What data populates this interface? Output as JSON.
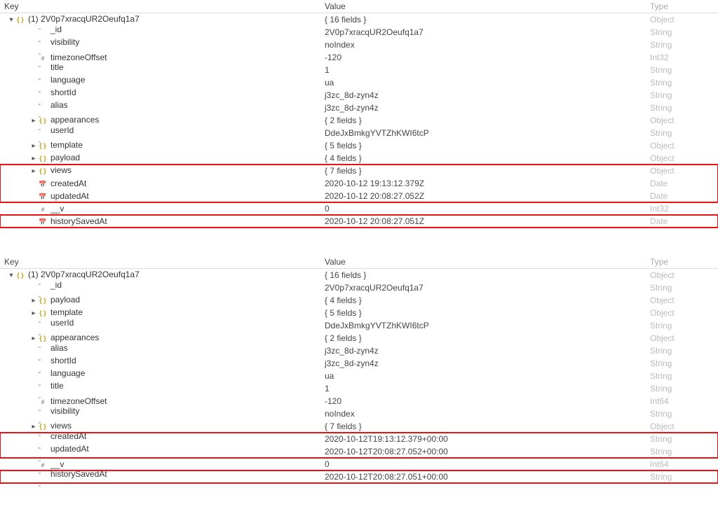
{
  "headers": {
    "key": "Key",
    "value": "Value",
    "type": "Type"
  },
  "panels": [
    {
      "rootExpander": "v",
      "rootKey": "(1) 2V0p7xracqUR2Oeufq1a7",
      "rootValue": "{ 16 fields }",
      "rootType": "Object",
      "rootIcon": "object",
      "rows": [
        {
          "exp": "",
          "icon": "string",
          "key": "_id",
          "value": "2V0p7xracqUR2Oeufq1a7",
          "type": "String",
          "indent": 2
        },
        {
          "exp": "",
          "icon": "string",
          "key": "visibility",
          "value": "noIndex",
          "type": "String",
          "indent": 2
        },
        {
          "exp": "",
          "icon": "int",
          "key": "timezoneOffset",
          "value": "-120",
          "type": "Int32",
          "indent": 2
        },
        {
          "exp": "",
          "icon": "string",
          "key": "title",
          "value": "1",
          "type": "String",
          "indent": 2
        },
        {
          "exp": "",
          "icon": "string",
          "key": "language",
          "value": "ua",
          "type": "String",
          "indent": 2
        },
        {
          "exp": "",
          "icon": "string",
          "key": "shortId",
          "value": "j3zc_8d-zyn4z",
          "type": "String",
          "indent": 2
        },
        {
          "exp": "",
          "icon": "string",
          "key": "alias",
          "value": "j3zc_8d-zyn4z",
          "type": "String",
          "indent": 2
        },
        {
          "exp": ">",
          "icon": "object",
          "key": "appearances",
          "value": "{ 2 fields }",
          "type": "Object",
          "indent": 2
        },
        {
          "exp": "",
          "icon": "string",
          "key": "userId",
          "value": "DdeJxBmkgYVTZhKWI6tcP",
          "type": "String",
          "indent": 2
        },
        {
          "exp": ">",
          "icon": "object",
          "key": "template",
          "value": "{ 5 fields }",
          "type": "Object",
          "indent": 2
        },
        {
          "exp": ">",
          "icon": "object",
          "key": "payload",
          "value": "{ 4 fields }",
          "type": "Object",
          "indent": 2
        },
        {
          "exp": ">",
          "icon": "object",
          "key": "views",
          "value": "{ 7 fields }",
          "type": "Object",
          "indent": 2,
          "hlTop": true
        },
        {
          "exp": "",
          "icon": "date",
          "key": "createdAt",
          "value": "2020-10-12 19:13:12.379Z",
          "type": "Date",
          "indent": 2,
          "hlMid": true
        },
        {
          "exp": "",
          "icon": "date",
          "key": "updatedAt",
          "value": "2020-10-12 20:08:27.052Z",
          "type": "Date",
          "indent": 2,
          "hlBot": true
        },
        {
          "exp": "",
          "icon": "int",
          "key": "__v",
          "value": "0",
          "type": "Int32",
          "indent": 2
        },
        {
          "exp": "",
          "icon": "date",
          "key": "historySavedAt",
          "value": "2020-10-12 20:08:27.051Z",
          "type": "Date",
          "indent": 2,
          "hlSingle": true
        }
      ]
    },
    {
      "rootExpander": "v",
      "rootKey": "(1) 2V0p7xracqUR2Oeufq1a7",
      "rootValue": "{ 16 fields }",
      "rootType": "Object",
      "rootIcon": "object",
      "rows": [
        {
          "exp": "",
          "icon": "string",
          "key": "_id",
          "value": "2V0p7xracqUR2Oeufq1a7",
          "type": "String",
          "indent": 2
        },
        {
          "exp": ">",
          "icon": "object",
          "key": "payload",
          "value": "{ 4 fields }",
          "type": "Object",
          "indent": 2
        },
        {
          "exp": ">",
          "icon": "object",
          "key": "template",
          "value": "{ 5 fields }",
          "type": "Object",
          "indent": 2
        },
        {
          "exp": "",
          "icon": "string",
          "key": "userId",
          "value": "DdeJxBmkgYVTZhKWI6tcP",
          "type": "String",
          "indent": 2
        },
        {
          "exp": ">",
          "icon": "object",
          "key": "appearances",
          "value": "{ 2 fields }",
          "type": "Object",
          "indent": 2
        },
        {
          "exp": "",
          "icon": "string",
          "key": "alias",
          "value": "j3zc_8d-zyn4z",
          "type": "String",
          "indent": 2
        },
        {
          "exp": "",
          "icon": "string",
          "key": "shortId",
          "value": "j3zc_8d-zyn4z",
          "type": "String",
          "indent": 2
        },
        {
          "exp": "",
          "icon": "string",
          "key": "language",
          "value": "ua",
          "type": "String",
          "indent": 2
        },
        {
          "exp": "",
          "icon": "string",
          "key": "title",
          "value": "1",
          "type": "String",
          "indent": 2
        },
        {
          "exp": "",
          "icon": "int",
          "key": "timezoneOffset",
          "value": "-120",
          "type": "Int64",
          "indent": 2
        },
        {
          "exp": "",
          "icon": "string",
          "key": "visibility",
          "value": "noIndex",
          "type": "String",
          "indent": 2
        },
        {
          "exp": ">",
          "icon": "object",
          "key": "views",
          "value": "{ 7 fields }",
          "type": "Object",
          "indent": 2
        },
        {
          "exp": "",
          "icon": "string",
          "key": "createdAt",
          "value": "2020-10-12T19:13:12.379+00:00",
          "type": "String",
          "indent": 2,
          "hlMid": true,
          "hlTop": true
        },
        {
          "exp": "",
          "icon": "string",
          "key": "updatedAt",
          "value": "2020-10-12T20:08:27.052+00:00",
          "type": "String",
          "indent": 2,
          "hlBot": true
        },
        {
          "exp": "",
          "icon": "int",
          "key": "__v",
          "value": "0",
          "type": "Int64",
          "indent": 2
        },
        {
          "exp": "",
          "icon": "string",
          "key": "historySavedAt",
          "value": "2020-10-12T20:08:27.051+00:00",
          "type": "String",
          "indent": 2,
          "hlSingle": true
        }
      ]
    }
  ]
}
